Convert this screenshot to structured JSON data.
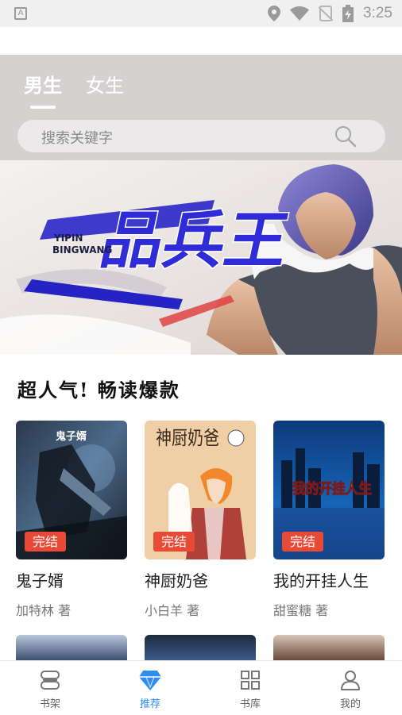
{
  "status_bar": {
    "time": "3:25",
    "app_icon_letter": "A",
    "icons": [
      "location-icon",
      "wifi-icon",
      "no-sim-icon",
      "battery-charging-icon"
    ]
  },
  "header": {
    "tabs": [
      {
        "label": "男生",
        "active": true
      },
      {
        "label": "女生",
        "active": false
      }
    ],
    "search": {
      "placeholder": "搜索关键字"
    }
  },
  "banner": {
    "title": "品兵王",
    "subtitle_line1": "YIPIN",
    "subtitle_line2": "BINGWANG"
  },
  "section": {
    "title": "超人气! 畅读爆款",
    "books": [
      {
        "title": "鬼子婿",
        "author": "加特林 著",
        "badge": "完结",
        "cover_text": "鬼子婿"
      },
      {
        "title": "神厨奶爸",
        "author": "小白羊 著",
        "badge": "完结",
        "cover_text": "神厨奶爸"
      },
      {
        "title": "我的开挂人生",
        "author": "甜蜜糖 著",
        "badge": "完结",
        "cover_text": "我的开挂人生"
      }
    ]
  },
  "bottom_nav": {
    "items": [
      {
        "label": "书架",
        "icon": "bookshelf-icon",
        "active": false
      },
      {
        "label": "推荐",
        "icon": "diamond-icon",
        "active": true
      },
      {
        "label": "书库",
        "icon": "grid-icon",
        "active": false
      },
      {
        "label": "我的",
        "icon": "profile-icon",
        "active": false
      }
    ]
  },
  "colors": {
    "header_bg": "#d6d1d1",
    "accent": "#2d8cf0",
    "badge": "#e94a36"
  }
}
